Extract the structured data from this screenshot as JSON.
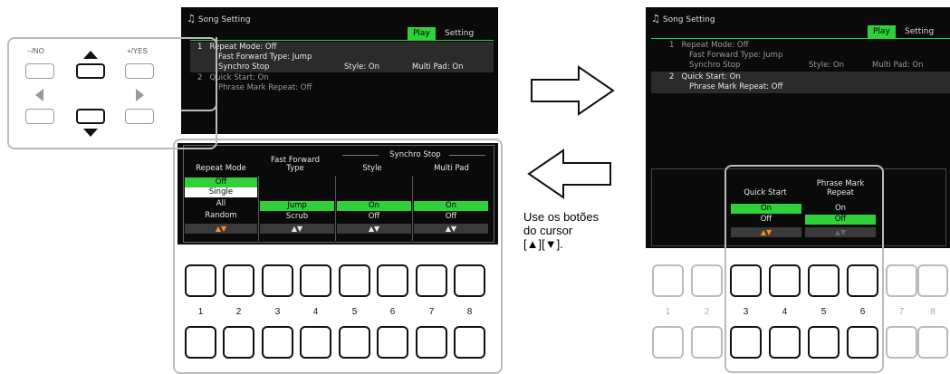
{
  "left_screen": {
    "title": "Song Setting",
    "tabs": [
      "Play",
      "Setting"
    ],
    "rows": [
      {
        "num": "1",
        "label": "Repeat Mode",
        "value": "Off"
      },
      {
        "num": "",
        "label": "Fast Forward Type",
        "value": "Jump"
      },
      {
        "num": "",
        "label": "Synchro Stop",
        "style": "Style: On",
        "multipad": "Multi Pad: On"
      },
      {
        "num": "2",
        "label": "Quick Start",
        "value": "On"
      },
      {
        "num": "",
        "label": "Phrase Mark Repeat",
        "value": "Off"
      }
    ],
    "sub_panel": {
      "repeat_mode_header": "Repeat Mode",
      "ff_header_1": "Fast Forward",
      "ff_header_2": "Type",
      "synchro_header": "Synchro Stop",
      "style_header": "Style",
      "multipad_header": "Multi Pad",
      "repeat_options": [
        "Off",
        "Single",
        "All",
        "Random"
      ],
      "ff_options": [
        "Jump",
        "Scrub"
      ],
      "style_options": [
        "On",
        "Off"
      ],
      "multipad_options": [
        "On",
        "Off"
      ],
      "arrows": [
        "▲▼",
        "▲▼",
        "▲▼",
        "▲▼"
      ]
    }
  },
  "panel_buttons": {
    "no_label": "−/NO",
    "yes_label": "+/YES"
  },
  "key_numbers": [
    "1",
    "2",
    "3",
    "4",
    "5",
    "6",
    "7",
    "8"
  ],
  "caption": {
    "line1": "Use os botões",
    "line2": "do cursor",
    "line3": "[▲][▼]."
  },
  "right_screen": {
    "title": "Song Setting",
    "tabs": [
      "Play",
      "Setting"
    ],
    "rows": [
      {
        "num": "1",
        "label": "Repeat Mode",
        "value": "Off"
      },
      {
        "num": "",
        "label": "Fast Forward Type",
        "value": "Jump"
      },
      {
        "num": "",
        "label": "Synchro Stop",
        "style": "Style: On",
        "multipad": "Multi Pad: On"
      },
      {
        "num": "2",
        "label": "Quick Start",
        "value": "On"
      },
      {
        "num": "",
        "label": "Phrase Mark Repeat",
        "value": "Off"
      }
    ],
    "sub_panel": {
      "quick_start_header": "Quick Start",
      "pmr_header_1": "Phrase Mark",
      "pmr_header_2": "Repeat",
      "qs_options": [
        "On",
        "Off"
      ],
      "pmr_options": [
        "On",
        "Off"
      ],
      "arrows": [
        "▲▼",
        "▲▼"
      ]
    }
  },
  "colors": {
    "accent": "#2fd03a",
    "arrow_orange": "#ff8a1e"
  }
}
